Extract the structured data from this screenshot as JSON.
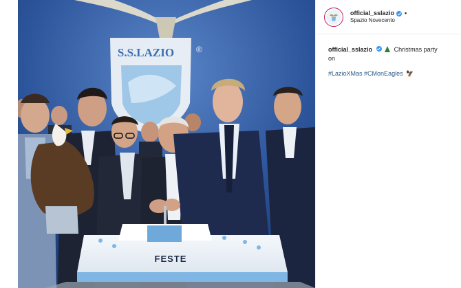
{
  "post": {
    "username": "official_sslazio",
    "location": "Spazio Novecento",
    "more_dot": "•",
    "caption_user": "official_sslazio",
    "caption_text_part1": "Christmas party",
    "caption_text_part2": "on",
    "hashtag1": "#LazioXMas",
    "hashtag2": "#CMonEagles",
    "eagle_emoji": "🦅"
  },
  "photo": {
    "logo_text": "S.S.LAZIO",
    "logo_registered": "®",
    "cake_text": "FESTE"
  },
  "colors": {
    "accent_link": "#2b5c8a",
    "verified": "#3897f0",
    "backdrop": "#2b4f8f"
  },
  "icons": {
    "verified": "verified-badge-icon",
    "tree": "christmas-tree-icon",
    "eagle": "eagle-emoji-icon"
  }
}
